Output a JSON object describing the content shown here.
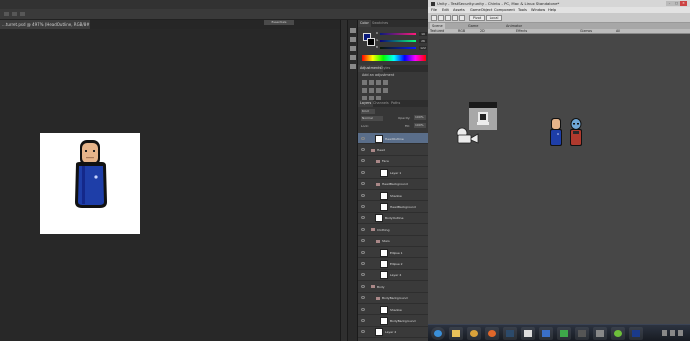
{
  "photoshop": {
    "workspace_label": "Essentials",
    "document_tab": "...turret.psd @ 497% (HeadOutline, RGB/8#) *",
    "panels": {
      "color_tabs": [
        "Color",
        "Swatches"
      ],
      "color_values": {
        "r": "10",
        "g": "26",
        "b": "122"
      },
      "channel_letters": [
        "R",
        "G",
        "B"
      ],
      "adjustment_tabs": [
        "Adjustments",
        "Styles"
      ],
      "adjustment_title": "Add an adjustment",
      "layer_tabs": [
        "Layers",
        "Channels",
        "Paths"
      ],
      "kind_filter": "Kind",
      "blend_mode": "Normal",
      "opacity_label": "Opacity:",
      "opacity_value": "100%",
      "lock_label": "Lock:",
      "fill_label": "Fill:",
      "fill_value": "100%"
    },
    "layers": [
      {
        "name": "HeadOutline",
        "type": "layer",
        "depth": 1,
        "selected": true
      },
      {
        "name": "Head",
        "type": "group",
        "depth": 0
      },
      {
        "name": "Face",
        "type": "group",
        "depth": 1
      },
      {
        "name": "Layer 1",
        "type": "layer",
        "depth": 2
      },
      {
        "name": "HeadBackground",
        "type": "group",
        "depth": 1
      },
      {
        "name": "Shadow",
        "type": "layer",
        "depth": 2
      },
      {
        "name": "HeadBackground",
        "type": "layer",
        "depth": 2
      },
      {
        "name": "BodyOutline",
        "type": "layer",
        "depth": 1
      },
      {
        "name": "Clothing",
        "type": "group",
        "depth": 0
      },
      {
        "name": "Stars",
        "type": "group",
        "depth": 1
      },
      {
        "name": "Ellipse 1",
        "type": "layer",
        "depth": 2
      },
      {
        "name": "Ellipse 2",
        "type": "layer",
        "depth": 2
      },
      {
        "name": "Layer 4",
        "type": "layer",
        "depth": 2
      },
      {
        "name": "Body",
        "type": "group",
        "depth": 0
      },
      {
        "name": "BodyBackground",
        "type": "group",
        "depth": 1
      },
      {
        "name": "Shadow",
        "type": "layer",
        "depth": 2
      },
      {
        "name": "BodyBackground",
        "type": "layer",
        "depth": 2
      },
      {
        "name": "Layer 2",
        "type": "layer",
        "depth": 1
      }
    ]
  },
  "unity": {
    "title": "Unity - TestSecurity.unity - Chintu - PC, Mac & Linux Standalone*",
    "window_buttons": [
      "–",
      "□",
      "✕"
    ],
    "menu": [
      "File",
      "Edit",
      "Assets",
      "GameObject",
      "Component",
      "Tools",
      "Window",
      "Help"
    ],
    "toolbar": {
      "pivot": "Pivot",
      "local": "Local"
    },
    "tabs": [
      "Scene",
      "Game",
      "Animator"
    ],
    "scenebar": {
      "shading": "Textured",
      "mode": "RGB",
      "dim": "2D",
      "effects": "Effects",
      "gizmos": "Gizmos",
      "search": "All"
    }
  },
  "colors": {
    "uniform_blue": "#1e3ea8",
    "uniform_red": "#b03a2e",
    "skin": "#e6b48a",
    "alien_blue": "#6fa8d8",
    "selection": "#5a6e8a"
  },
  "taskbar": {
    "apps": [
      "windows-start",
      "folder",
      "chrome",
      "firefox",
      "steam",
      "unity",
      "app-blue",
      "app-green",
      "media",
      "app-gray",
      "spotify",
      "photoshop"
    ]
  }
}
